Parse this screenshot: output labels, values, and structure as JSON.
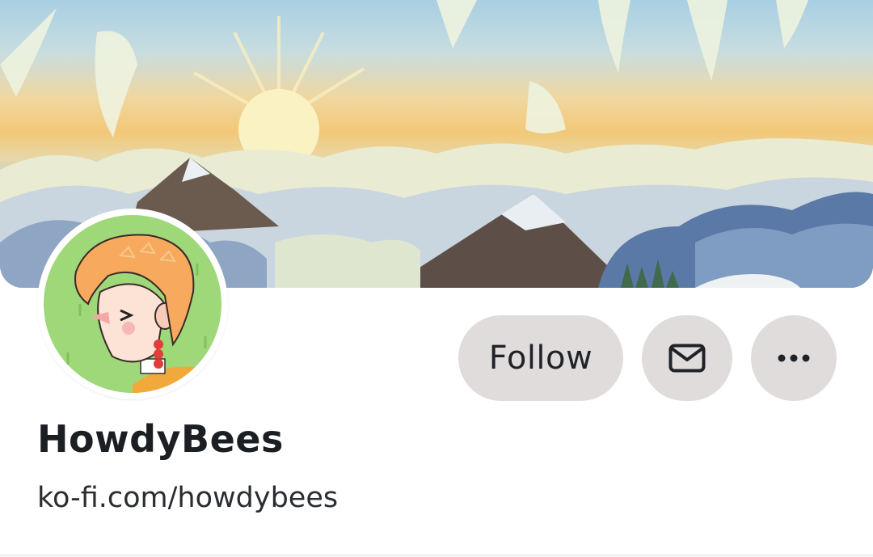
{
  "profile": {
    "name": "HowdyBees",
    "url": "ko-fi.com/howdybees"
  },
  "actions": {
    "follow_label": "Follow",
    "message_icon": "mail-icon",
    "more_icon": "more-horizontal-icon"
  },
  "colors": {
    "button_bg": "#e1dcdc",
    "text": "#1b1f24"
  }
}
